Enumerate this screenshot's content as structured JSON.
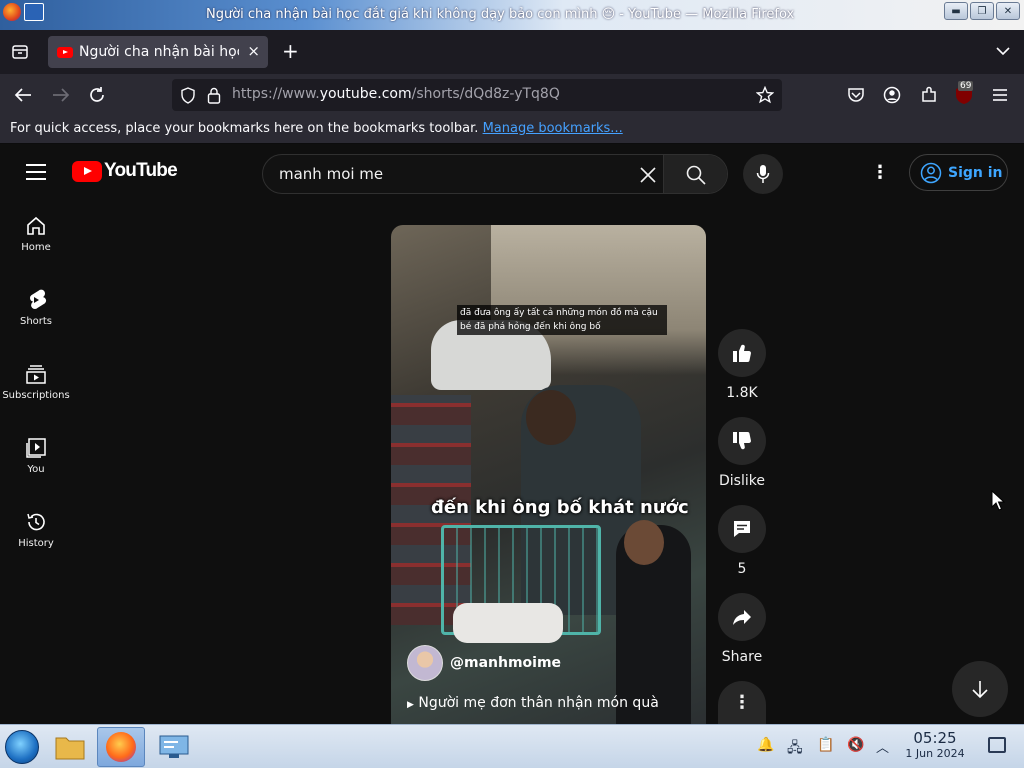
{
  "window": {
    "title": "Người cha nhận bài học đắt giá khi không dạy bảo con mình 😔 - YouTube — Mozilla Firefox",
    "controls": {
      "minimize": "▬",
      "maximize": "❐",
      "close": "✕"
    }
  },
  "browser": {
    "tab_title": "Người cha nhận bài học đắt giá khi không dạy bảo con mình 😔 - YouTube",
    "tab_close": "×",
    "new_tab": "+",
    "url_prefix": "https://www.",
    "url_domain": "youtube.com",
    "url_path": "/shorts/dQd8z-yTq8Q",
    "extension_badge": "69",
    "bookmarks_bar_text": "For quick access, place your bookmarks here on the bookmarks toolbar.",
    "bookmarks_link": "Manage bookmarks..."
  },
  "youtube": {
    "logo_text": "YouTube",
    "search_value": "manh moi me",
    "sign_in": "Sign in",
    "sidebar": [
      {
        "label": "Home",
        "icon": "home-icon"
      },
      {
        "label": "Shorts",
        "icon": "shorts-icon"
      },
      {
        "label": "Subscriptions",
        "icon": "subscriptions-icon"
      },
      {
        "label": "You",
        "icon": "you-icon"
      },
      {
        "label": "History",
        "icon": "history-icon"
      }
    ],
    "short": {
      "subtitle_small": "đã đưa ông ấy tất cả những món đồ mà cậu bé đã phá hỏng đến khi ông bố",
      "caption": "đến khi ông bố khát nước",
      "channel": "@manhmoime",
      "video_title": "Người mẹ đơn thân nhận món quà"
    },
    "actions": {
      "like_count": "1.8K",
      "dislike_label": "Dislike",
      "comment_count": "5",
      "share_label": "Share"
    }
  },
  "taskbar": {
    "time": "05:25",
    "date": "1 Jun 2024"
  },
  "colors": {
    "yt_red": "#ff0000",
    "link_blue": "#3ea6ff",
    "bg": "#0f0f0f"
  }
}
